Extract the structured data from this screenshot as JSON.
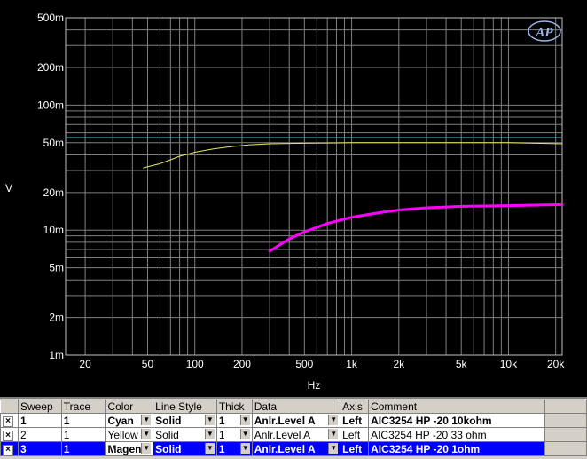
{
  "chart_data": {
    "type": "line",
    "xlabel": "Hz",
    "ylabel": "V",
    "x_scale": "log",
    "y_scale": "log",
    "xlim": [
      15,
      22000
    ],
    "ylim": [
      0.001,
      0.5
    ],
    "x_ticks": [
      "20",
      "50",
      "100",
      "200",
      "500",
      "1k",
      "2k",
      "5k",
      "10k",
      "20k"
    ],
    "x_tick_values": [
      20,
      50,
      100,
      200,
      500,
      1000,
      2000,
      5000,
      10000,
      20000
    ],
    "y_ticks": [
      "500m",
      "200m",
      "100m",
      "50m",
      "20m",
      "10m",
      "5m",
      "2m",
      "1m"
    ],
    "y_tick_values": [
      0.5,
      0.2,
      0.1,
      0.05,
      0.02,
      0.01,
      0.005,
      0.002,
      0.001
    ],
    "grid": true,
    "series": [
      {
        "name": "AIC3254 HP -20 10kohm",
        "color": "#40c0d0",
        "width": 1,
        "x": [
          15,
          30,
          100,
          300,
          1000,
          5000,
          20000,
          22000
        ],
        "y": [
          0.055,
          0.055,
          0.055,
          0.055,
          0.055,
          0.055,
          0.055,
          0.055
        ]
      },
      {
        "name": "AIC3254 HP -20 33 ohm",
        "color": "#e8e860",
        "width": 1,
        "x": [
          47,
          60,
          70,
          80,
          90,
          100,
          130,
          170,
          220,
          300,
          500,
          1000,
          3000,
          10000,
          22000
        ],
        "y": [
          0.0315,
          0.034,
          0.0365,
          0.039,
          0.0405,
          0.042,
          0.0445,
          0.0465,
          0.048,
          0.049,
          0.0495,
          0.05,
          0.05,
          0.05,
          0.049
        ]
      },
      {
        "name": "AIC3254 HP -20 1ohm",
        "color": "#ff00ff",
        "width": 3,
        "x": [
          300,
          400,
          500,
          700,
          1000,
          1500,
          2000,
          3000,
          5000,
          10000,
          20000,
          22000
        ],
        "y": [
          0.0068,
          0.0085,
          0.0097,
          0.0113,
          0.0127,
          0.0138,
          0.0145,
          0.0151,
          0.0155,
          0.0157,
          0.016,
          0.016
        ]
      }
    ]
  },
  "table": {
    "headers": [
      "Sweep",
      "Trace",
      "Color",
      "Line Style",
      "Thick",
      "Data",
      "Axis",
      "Comment"
    ],
    "rows": [
      {
        "sweep": "1",
        "trace": "1",
        "color": "Cyan",
        "style": "Solid",
        "thick": "1",
        "data": "Anlr.Level A",
        "axis": "Left",
        "comment": "AIC3254 HP -20 10kohm",
        "checked": "×"
      },
      {
        "sweep": "2",
        "trace": "1",
        "color": "Yellow",
        "style": "Solid",
        "thick": "1",
        "data": "Anlr.Level A",
        "axis": "Left",
        "comment": "AIC3254 HP -20 33 ohm",
        "checked": "×"
      },
      {
        "sweep": "3",
        "trace": "1",
        "color": "Magenta",
        "style": "Solid",
        "thick": "1",
        "data": "Anlr.Level A",
        "axis": "Left",
        "comment": "AIC3254 HP -20 1ohm",
        "checked": "×"
      }
    ]
  },
  "logo_text": "AP",
  "colors": {
    "background": "#000000",
    "grid": "#808080",
    "text": "#ffffff"
  }
}
